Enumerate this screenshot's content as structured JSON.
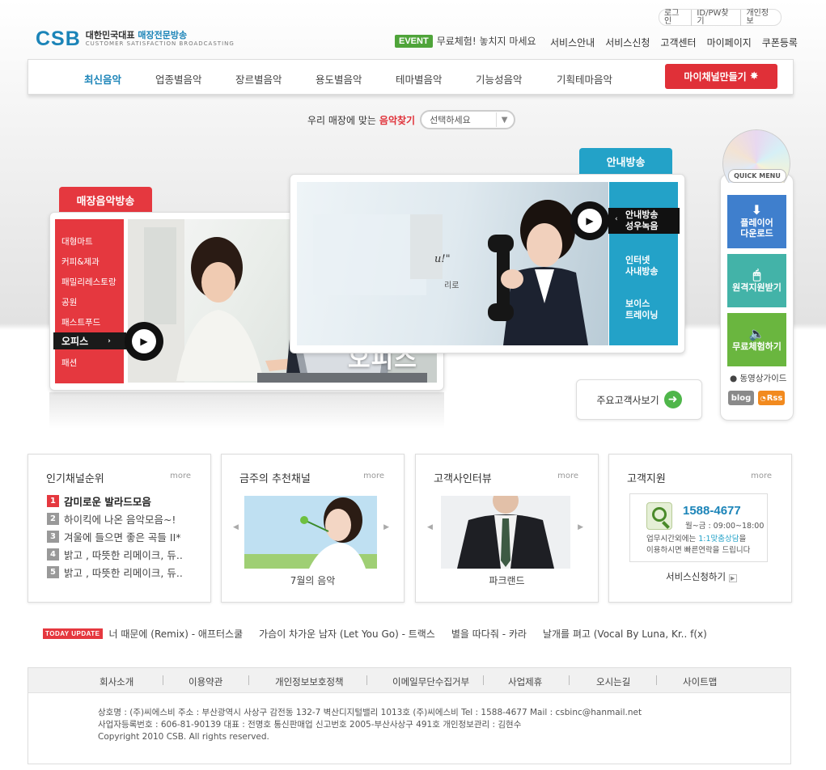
{
  "header": {
    "logo_mark": "CSB",
    "logo_line1_a": "대한민국대표",
    "logo_line1_b": "매장전문방송",
    "logo_line2": "CUSTOMER SATISFACTION BROADCASTING",
    "util_links": [
      "로그인",
      "ID/PW찾기",
      "개인정보"
    ],
    "event_badge": "EVENT",
    "event_text": "무료체험! 놓치지 마세요",
    "top_menu": [
      "서비스안내",
      "서비스신청",
      "고객센터",
      "마이페이지",
      "쿠폰등록"
    ]
  },
  "gnb": {
    "items": [
      "최신음악",
      "업종별음악",
      "장르별음악",
      "용도별음악",
      "테마별음악",
      "기능성음악",
      "기획테마음악"
    ],
    "active": "최신음악",
    "my_channel_button": "마이채널만들기"
  },
  "finder": {
    "label_prefix": "우리 매장에 맞는",
    "label_highlight": "음악찾기",
    "select_value": "선택하세요"
  },
  "store_panel": {
    "tab_label": "매장음악방송",
    "categories": [
      "대형마트",
      "커피&제과",
      "패밀리레스토랑",
      "공원",
      "패스트푸드",
      "오피스",
      "패션"
    ],
    "active_category": "오피스",
    "photo_caption": "오피스"
  },
  "guide_panel": {
    "tab_label": "안내방송",
    "items": [
      "안내방송\n성우녹음",
      "인터넷\n사내방송",
      "보이스\n트레이닝"
    ],
    "photo_text_1": "u!\"",
    "photo_text_2": "리로"
  },
  "major_clients_button": "주요고객사보기",
  "quick_menu": {
    "label": "QUICK MENU",
    "buttons": [
      "플레이어\n다운로드",
      "원격지원받기",
      "무료체험하기"
    ],
    "video_guide": "동영상가이드",
    "blog": "blog",
    "rss": "Rss"
  },
  "boxes": {
    "ranking": {
      "title": "인기채널순위",
      "more": "more",
      "items": [
        {
          "rank": "1",
          "title": "감미로운 발라드모음"
        },
        {
          "rank": "2",
          "title": "하이킥에 나온 음악모음~!"
        },
        {
          "rank": "3",
          "title": "겨울에 들으면 좋은 곡들 II*"
        },
        {
          "rank": "4",
          "title": "밝고 , 따뜻한 리메이크, 듀.."
        },
        {
          "rank": "5",
          "title": "밝고 , 따뜻한 리메이크, 듀.."
        }
      ]
    },
    "recommend": {
      "title": "금주의 추천채널",
      "more": "more",
      "caption": "7월의 음악"
    },
    "interview": {
      "title": "고객사인터뷰",
      "more": "more",
      "caption": "파크랜드"
    },
    "support": {
      "title": "고객지원",
      "more": "more",
      "phone": "1588-4677",
      "hours": "월~금 : 09:00~18:00",
      "desc_1a": "업무시간외에는",
      "desc_1b": "1:1맞춤상담",
      "desc_1c": "을",
      "desc_2": "이용하시면 빠른연락을 드립니다",
      "link": "서비스신청하기"
    }
  },
  "today_update": {
    "badge": "TODAY UPDATE",
    "songs": [
      "너 때문에 (Remix) - 애프터스쿨",
      "가슴이 차가운 남자 (Let You Go) - 트랙스",
      "별을 따다줘 - 카라",
      "날개를 펴고 (Vocal By Luna, Kr.. f(x)"
    ]
  },
  "footer": {
    "nav": [
      "회사소개",
      "이용약관",
      "개인정보보호정책",
      "이메일무단수집거부",
      "사업제휴",
      "오시는길",
      "사이트맵"
    ],
    "line1": "상호명 : (주)씨에스비    주소 : 부산광역시 사상구 감전동 132-7 벽산디지털밸리 1013호 (주)씨에스비    Tel : 1588-4677     Mail : csbinc@hanmail.net",
    "line2": "사업자등록번호 : 606-81-90139    대표 : 전명호    통신판매업 신고번호 2005-부산사상구 491호    개인정보관리 : 김현수",
    "line3": "Copyright 2010 CSB. All rights reserved."
  },
  "colors": {
    "brand_blue": "#1b84b8",
    "red": "#e5383f",
    "teal": "#23a2c8",
    "green": "#4fa43a"
  }
}
